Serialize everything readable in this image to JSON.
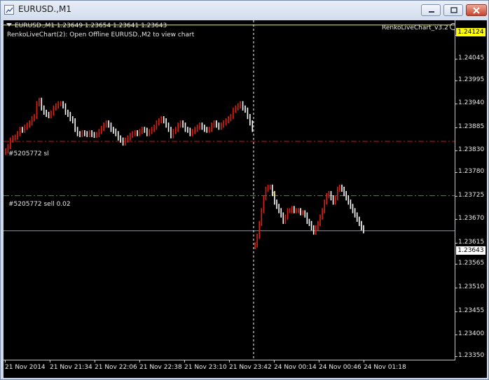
{
  "window": {
    "title": "EURUSD.,M1",
    "controls": [
      "minimize",
      "maximize",
      "close"
    ]
  },
  "chart_header": {
    "symbol_info": "EURUSD.,M1  1.23649 1.23654 1.23641 1.23643",
    "indicator_comment": "RenkoLiveChart(2): Open Offline EURUSD.,M2 to view chart",
    "ea_name": "RenkoLiveChart_v3.2"
  },
  "order_lines": {
    "stop_loss_label": "#5205772 sl",
    "order_label": "#5205772 sell 0.02",
    "sell_marker": "s"
  },
  "price_tags": {
    "ask": "1.24124",
    "bid": "1.23643"
  },
  "colors": {
    "background": "#000000",
    "bull_bar": "#e02010",
    "bear_bar": "#ffffff",
    "stop_loss_line": "#c01a10",
    "order_line": "#32a032",
    "bid_line": "#8a98b0",
    "ask_line": "#ffff00"
  },
  "chart_data": {
    "type": "line",
    "title": "EURUSD.,M1",
    "y_ticks": [
      "1.24100",
      "1.24045",
      "1.23995",
      "1.23940",
      "1.23885",
      "1.23830",
      "1.23780",
      "1.23725",
      "1.23670",
      "1.23615",
      "1.23565",
      "1.23510",
      "1.23455",
      "1.23400",
      "1.23350"
    ],
    "x_ticks": [
      "21 Nov 2014",
      "21 Nov 21:34",
      "21 Nov 22:06",
      "21 Nov 22:38",
      "21 Nov 23:10",
      "21 Nov 23:42",
      "24 Nov 00:14",
      "24 Nov 00:46",
      "24 Nov 01:18"
    ],
    "ylim": [
      1.2334,
      1.24135
    ],
    "grid": false,
    "levels": {
      "ask": 1.24124,
      "bid": 1.23643,
      "stop_loss": 1.23852,
      "order_price": 1.23725
    },
    "series": [
      {
        "values": [
          1.2383,
          1.2384,
          1.23855,
          1.2386,
          1.23862,
          1.2387,
          1.2388,
          1.23878,
          1.23885,
          1.2389,
          1.23895,
          1.23905,
          1.2391,
          1.2394,
          1.23948,
          1.2393,
          1.2392,
          1.23915,
          1.23912,
          1.23918,
          1.2393,
          1.23935,
          1.2394,
          1.2394,
          1.23935,
          1.2392,
          1.23915,
          1.23905,
          1.239,
          1.2388,
          1.2387,
          1.23868,
          1.23872,
          1.2387,
          1.23868,
          1.23872,
          1.23868,
          1.23866,
          1.23868,
          1.23875,
          1.23882,
          1.2389,
          1.23895,
          1.2389,
          1.2388,
          1.23876,
          1.2387,
          1.2386,
          1.23855,
          1.23848,
          1.23855,
          1.2386,
          1.23866,
          1.2387,
          1.23872,
          1.2387,
          1.23875,
          1.2388,
          1.23878,
          1.2387,
          1.23875,
          1.2388,
          1.23885,
          1.23895,
          1.239,
          1.23905,
          1.239,
          1.2389,
          1.2388,
          1.23865,
          1.23875,
          1.2388,
          1.2389,
          1.23895,
          1.2389,
          1.2388,
          1.23878,
          1.2387,
          1.23875,
          1.2388,
          1.23885,
          1.2389,
          1.23885,
          1.2388,
          1.23878,
          1.2388,
          1.2389,
          1.23895,
          1.2389,
          1.23885,
          1.2389,
          1.23895,
          1.239,
          1.23905,
          1.2391,
          1.23925,
          1.2393,
          1.23935,
          1.2394,
          1.2393,
          1.23925,
          1.2391,
          1.23895,
          1.2388
        ],
        "gap_after": 103,
        "values_after_gap": [
          1.2361,
          1.2363,
          1.2366,
          1.2369,
          1.2372,
          1.2374,
          1.23745,
          1.23745,
          1.2373,
          1.2371,
          1.237,
          1.2369,
          1.2368,
          1.23665,
          1.23675,
          1.2369,
          1.2369,
          1.23695,
          1.2369,
          1.2369,
          1.2369,
          1.23685,
          1.23685,
          1.2368,
          1.23665,
          1.2366,
          1.2365,
          1.2364,
          1.2365,
          1.2366,
          1.23675,
          1.2369,
          1.2371,
          1.23725,
          1.2373,
          1.2372,
          1.2371,
          1.2372,
          1.2374,
          1.23745,
          1.2374,
          1.2373,
          1.2372,
          1.2371,
          1.237,
          1.2369,
          1.2368,
          1.2367,
          1.2366,
          1.2365,
          1.23643
        ]
      }
    ]
  }
}
